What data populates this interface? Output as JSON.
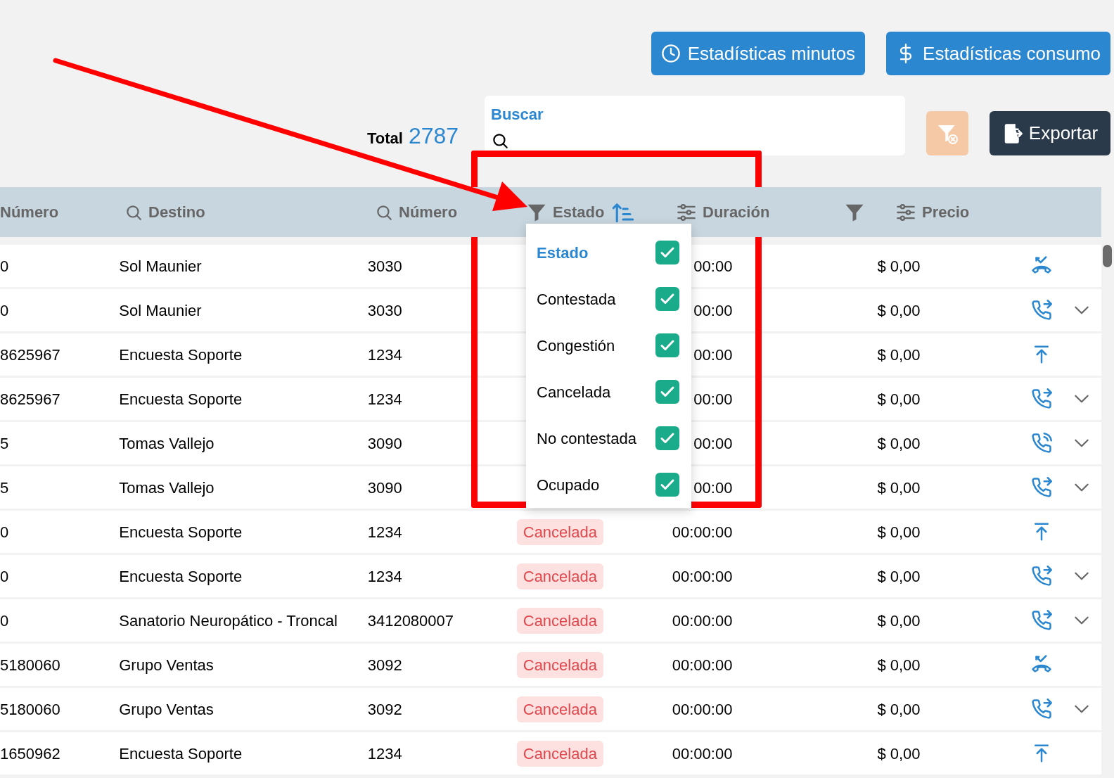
{
  "buttons": [
    {
      "label": "Estadísticas minutos",
      "kind": "clock"
    },
    {
      "label": "Estadísticas consumo",
      "kind": "dollar"
    }
  ],
  "total": {
    "label": "Total",
    "value": "2787"
  },
  "search": {
    "label": "Buscar"
  },
  "export_button": {
    "label": "Exportar"
  },
  "table": {
    "columns": [
      {
        "label": "Número",
        "kind": "plain"
      },
      {
        "label": "Destino",
        "kind": "search"
      },
      {
        "label": "Número",
        "kind": "search"
      },
      {
        "label": "Estado",
        "kind": "filter_sort"
      },
      {
        "label": "Duración",
        "kind": "range"
      },
      {
        "label": "Precio",
        "kind": "filter_range"
      }
    ],
    "rows": [
      {
        "number": "0",
        "destination": "Sol Maunier",
        "extension": "3030",
        "duration": "00:00",
        "price": "$ 0,00",
        "kind": "missed",
        "expandable": false
      },
      {
        "number": "0",
        "destination": "Sol Maunier",
        "extension": "3030",
        "duration": "00:00",
        "price": "$ 0,00",
        "kind": "forwarded",
        "expandable": true
      },
      {
        "number": "8625967",
        "destination": "Encuesta Soporte",
        "extension": "1234",
        "duration": "00:00",
        "price": "$ 0,00",
        "kind": "upload",
        "expandable": false
      },
      {
        "number": "8625967",
        "destination": "Encuesta Soporte",
        "extension": "1234",
        "duration": "00:00",
        "price": "$ 0,00",
        "kind": "forwarded",
        "expandable": true
      },
      {
        "number": "5",
        "destination": "Tomas Vallejo",
        "extension": "3090",
        "duration": "00:00",
        "price": "$ 0,00",
        "kind": "ringing",
        "expandable": true
      },
      {
        "number": "5",
        "destination": "Tomas Vallejo",
        "extension": "3090",
        "duration": "00:00",
        "price": "$ 0,00",
        "kind": "forwarded",
        "expandable": true
      },
      {
        "number": "0",
        "destination": "Encuesta Soporte",
        "extension": "1234",
        "status": "Cancelada",
        "duration": "00:00:00",
        "price": "$ 0,00",
        "kind": "upload",
        "expandable": false
      },
      {
        "number": "0",
        "destination": "Encuesta Soporte",
        "extension": "1234",
        "status": "Cancelada",
        "duration": "00:00:00",
        "price": "$ 0,00",
        "kind": "forwarded",
        "expandable": true
      },
      {
        "number": "0",
        "destination": "Sanatorio Neuropático - Troncal",
        "extension": "3412080007",
        "status": "Cancelada",
        "duration": "00:00:00",
        "price": "$ 0,00",
        "kind": "forwarded",
        "expandable": true
      },
      {
        "number": "5180060",
        "destination": "Grupo Ventas",
        "extension": "3092",
        "status": "Cancelada",
        "duration": "00:00:00",
        "price": "$ 0,00",
        "kind": "missed",
        "expandable": false
      },
      {
        "number": "5180060",
        "destination": "Grupo Ventas",
        "extension": "3092",
        "status": "Cancelada",
        "duration": "00:00:00",
        "price": "$ 0,00",
        "kind": "forwarded",
        "expandable": true
      },
      {
        "number": "1650962",
        "destination": "Encuesta Soporte",
        "extension": "1234",
        "status": "Cancelada",
        "duration": "00:00:00",
        "price": "$ 0,00",
        "kind": "upload",
        "expandable": false
      }
    ]
  },
  "status_filter": {
    "title": "Estado",
    "checked": true,
    "options": [
      {
        "label": "Contestada",
        "checked": true
      },
      {
        "label": "Congestión",
        "checked": true
      },
      {
        "label": "Cancelada",
        "checked": true
      },
      {
        "label": "No contestada",
        "checked": true
      },
      {
        "label": "Ocupado",
        "checked": true
      }
    ]
  }
}
